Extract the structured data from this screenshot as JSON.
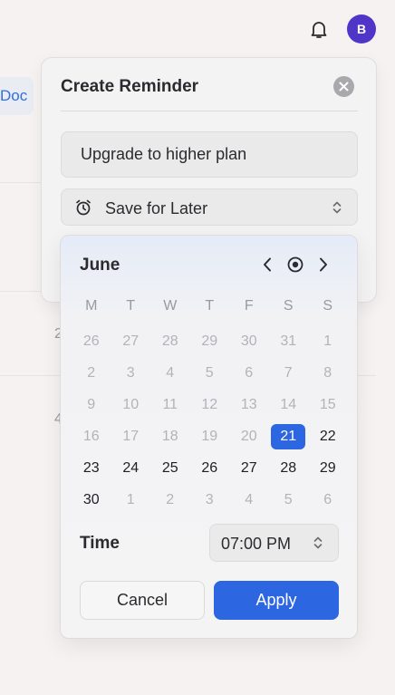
{
  "background": {
    "doc_pill_label": "Doc",
    "row_numbers": [
      "2",
      "4"
    ]
  },
  "header": {
    "bell_icon": "bell-icon",
    "avatar_initial": "B",
    "avatar_color": "#4f36c9"
  },
  "reminder": {
    "title": "Create Reminder",
    "close_icon": "close-icon",
    "text_value": "Upgrade to higher plan",
    "category": {
      "icon": "alarm-clock-icon",
      "selected": "Save for Later"
    }
  },
  "calendar": {
    "month": "June",
    "weekdays": [
      "M",
      "T",
      "W",
      "T",
      "F",
      "S",
      "S"
    ],
    "days": [
      {
        "label": "26",
        "current": false
      },
      {
        "label": "27",
        "current": false
      },
      {
        "label": "28",
        "current": false
      },
      {
        "label": "29",
        "current": false
      },
      {
        "label": "30",
        "current": false
      },
      {
        "label": "31",
        "current": false
      },
      {
        "label": "1",
        "current": false
      },
      {
        "label": "2",
        "current": false
      },
      {
        "label": "3",
        "current": false
      },
      {
        "label": "4",
        "current": false
      },
      {
        "label": "5",
        "current": false
      },
      {
        "label": "6",
        "current": false
      },
      {
        "label": "7",
        "current": false
      },
      {
        "label": "8",
        "current": false
      },
      {
        "label": "9",
        "current": false
      },
      {
        "label": "10",
        "current": false
      },
      {
        "label": "11",
        "current": false
      },
      {
        "label": "12",
        "current": false
      },
      {
        "label": "13",
        "current": false
      },
      {
        "label": "14",
        "current": false
      },
      {
        "label": "15",
        "current": false
      },
      {
        "label": "16",
        "current": false
      },
      {
        "label": "17",
        "current": false
      },
      {
        "label": "18",
        "current": false
      },
      {
        "label": "19",
        "current": false
      },
      {
        "label": "20",
        "current": false
      },
      {
        "label": "21",
        "current": true,
        "selected": true
      },
      {
        "label": "22",
        "current": true
      },
      {
        "label": "23",
        "current": true
      },
      {
        "label": "24",
        "current": true
      },
      {
        "label": "25",
        "current": true
      },
      {
        "label": "26",
        "current": true
      },
      {
        "label": "27",
        "current": true
      },
      {
        "label": "28",
        "current": true
      },
      {
        "label": "29",
        "current": true
      },
      {
        "label": "30",
        "current": true
      },
      {
        "label": "1",
        "current": false
      },
      {
        "label": "2",
        "current": false
      },
      {
        "label": "3",
        "current": false
      },
      {
        "label": "4",
        "current": false
      },
      {
        "label": "5",
        "current": false
      },
      {
        "label": "6",
        "current": false
      }
    ],
    "time_label": "Time",
    "time_value": "07:00 PM",
    "cancel_label": "Cancel",
    "apply_label": "Apply",
    "accent_color": "#2c66e0"
  }
}
